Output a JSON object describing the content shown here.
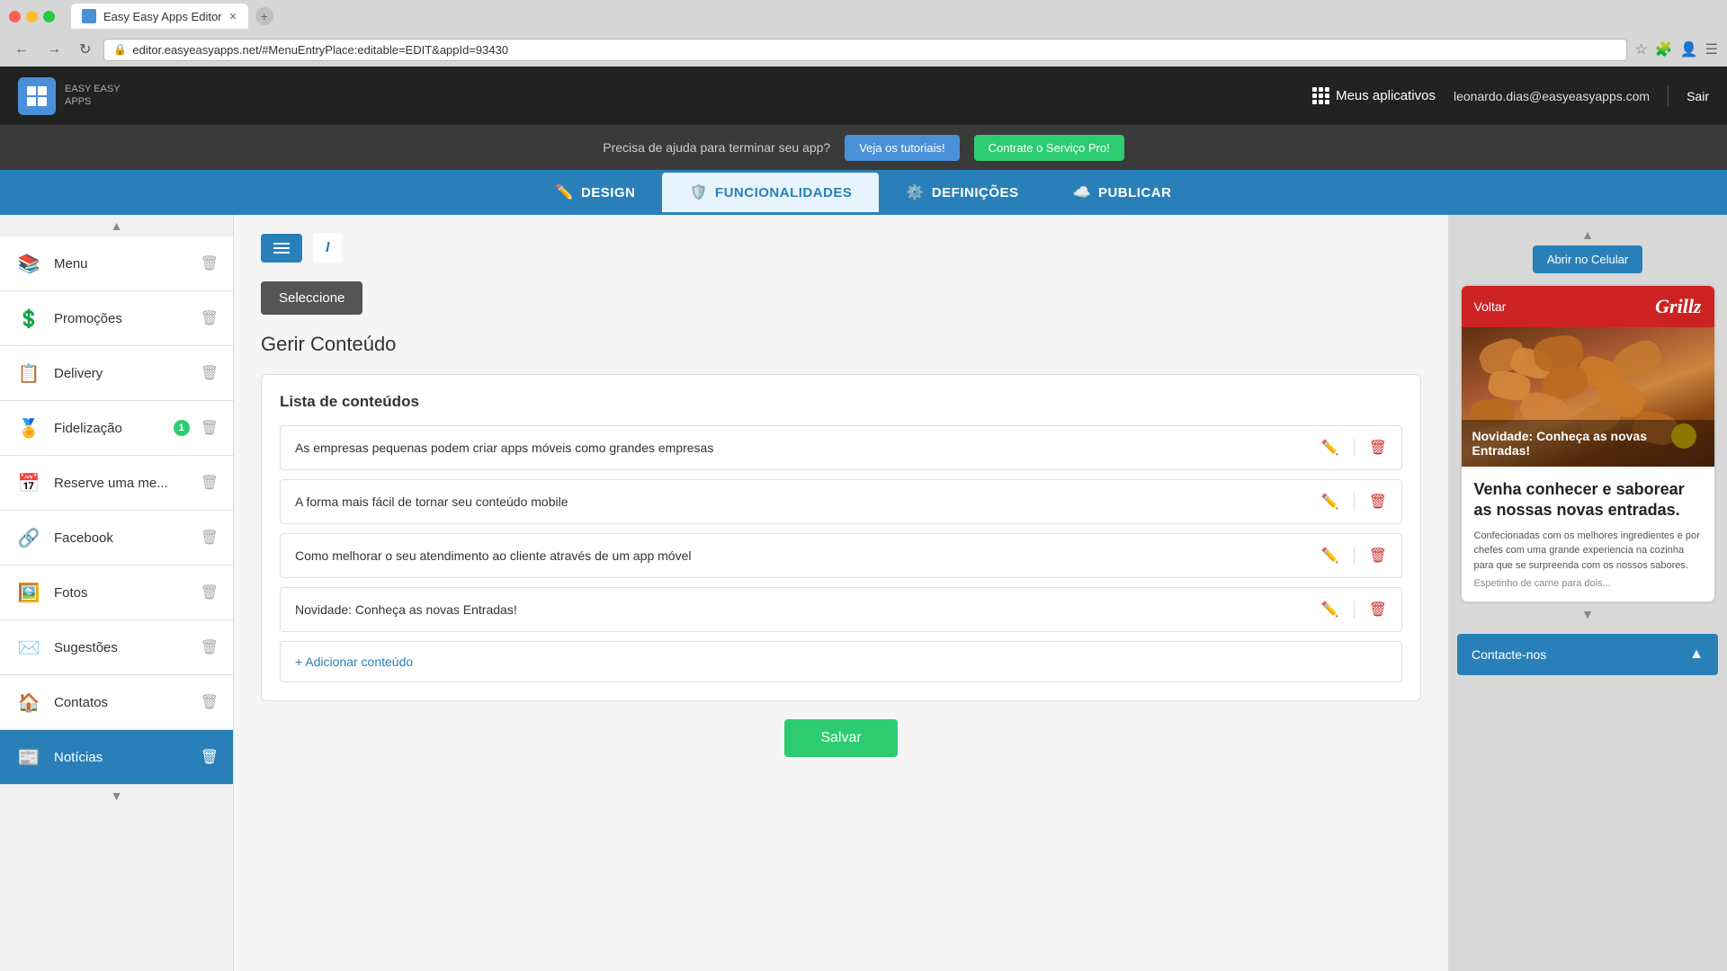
{
  "browser": {
    "tab_title": "Easy Easy Apps Editor",
    "address": "editor.easyeasyapps.net/#MenuEntryPlace:editable=EDIT&appId=93430",
    "back_btn": "←",
    "forward_btn": "→",
    "refresh_btn": "↻"
  },
  "header": {
    "logo_text": "EASY EASY",
    "logo_subtext": "APPS",
    "apps_label": "Meus aplicativos",
    "email": "leonardo.dias@easyeasyapps.com",
    "sair_label": "Sair"
  },
  "help_banner": {
    "text": "Precisa de ajuda para terminar seu app?",
    "btn_tutorials": "Veja os tutoriais!",
    "btn_pro": "Contrate o Serviço Pro!"
  },
  "nav_tabs": [
    {
      "id": "design",
      "label": "DESIGN",
      "icon": "✏️",
      "active": false
    },
    {
      "id": "funcionalidades",
      "label": "FUNCIONALIDADES",
      "icon": "🛡️",
      "active": true
    },
    {
      "id": "definicoes",
      "label": "DEFINIÇÕES",
      "icon": "⚙️",
      "active": false
    },
    {
      "id": "publicar",
      "label": "PUBLICAR",
      "icon": "☁️",
      "active": false
    }
  ],
  "sidebar": {
    "items": [
      {
        "id": "menu",
        "label": "Menu",
        "icon": "📚",
        "active": false
      },
      {
        "id": "promocoes",
        "label": "Promoções",
        "icon": "💲",
        "active": false
      },
      {
        "id": "delivery",
        "label": "Delivery",
        "icon": "📋",
        "active": false
      },
      {
        "id": "fidelizacao",
        "label": "Fidelização",
        "icon": "🏅",
        "badge": "1",
        "active": false
      },
      {
        "id": "reserve",
        "label": "Reserve uma me...",
        "icon": "📅",
        "active": false
      },
      {
        "id": "facebook",
        "label": "Facebook",
        "icon": "🔗",
        "active": false
      },
      {
        "id": "fotos",
        "label": "Fotos",
        "icon": "🖼️",
        "active": false
      },
      {
        "id": "sugestoes",
        "label": "Sugestões",
        "icon": "✉️",
        "active": false
      },
      {
        "id": "contatos",
        "label": "Contatos",
        "icon": "🏠",
        "active": false
      },
      {
        "id": "noticias",
        "label": "Notícias",
        "icon": "📰",
        "active": true
      }
    ]
  },
  "editor": {
    "select_btn_label": "Seleccione",
    "section_title": "Gerir Conteúdo",
    "list_header": "Lista de conteúdos",
    "content_items": [
      {
        "text": "As empresas pequenas podem criar apps móveis como grandes empresas"
      },
      {
        "text": "A forma mais fácil de tornar seu conteúdo mobile"
      },
      {
        "text": "Como melhorar o seu atendimento ao cliente através de um app móvel"
      },
      {
        "text": "Novidade: Conheça as novas Entradas!"
      }
    ],
    "add_content_label": "+ Adicionar conteúdo",
    "save_label": "Salvar"
  },
  "preview": {
    "open_mobile_label": "Abrir no Celular",
    "phone": {
      "back_label": "Voltar",
      "brand_name": "Grillz",
      "hero_title": "Novidade: Conheça as novas Entradas!",
      "main_title": "Venha conhecer e saborear as nossas novas entradas.",
      "description": "Confecionadas com os melhores ingredientes e por chefes com uma grande experiencia na cozinha para que se surpreenda com os nossos sabores.",
      "fade_text": "Espetinho de carne para dois..."
    },
    "contacte_label": "Contacte-nos"
  }
}
